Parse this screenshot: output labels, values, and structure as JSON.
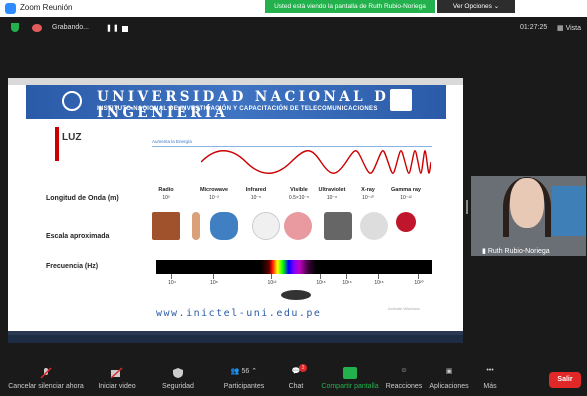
{
  "window": {
    "title": "Zoom Reunión"
  },
  "banner": {
    "share_text": "Usted está viendo la pantalla de Ruth Rubio-Noriega",
    "view_options": "Ver Opciones ⌄"
  },
  "meeting": {
    "recording_label": "Grabando...",
    "clock": "01:27:25",
    "view_label": "Vista"
  },
  "slide": {
    "univ_name": "UNIVERSIDAD NACIONAL DE INGENIERÍA",
    "univ_sub": "INSTITUTO NACIONAL DE INVESTIGACIÓN Y CAPACITACIÓN DE TELECOMUNICACIONES",
    "topic": "LUZ",
    "energy_label": "Aumenta la Energía",
    "row_wavelength": "Longitud de Onda (m)",
    "row_scale": "Escala aproximada",
    "row_frequency": "Frecuencia (Hz)",
    "categories": [
      {
        "name": "Radio",
        "wl": "10³"
      },
      {
        "name": "Microwave",
        "wl": "10⁻²"
      },
      {
        "name": "Infrared",
        "wl": "10⁻⁵"
      },
      {
        "name": "Visible",
        "wl": "0.5×10⁻⁶"
      },
      {
        "name": "Ultraviolet",
        "wl": "10⁻⁸"
      },
      {
        "name": "X-ray",
        "wl": "10⁻¹⁰"
      },
      {
        "name": "Gamma ray",
        "wl": "10⁻¹²"
      }
    ],
    "frequencies": [
      "10⁴",
      "10⁸",
      "10¹²",
      "10¹⁵",
      "10¹⁶",
      "10¹⁸",
      "10²⁰"
    ],
    "website": "www.inictel-uni.edu.pe",
    "activate": "Activate Windows"
  },
  "participant": {
    "name": "Ruth Rubio-Noriega"
  },
  "toolbar": {
    "mute": "Cancelar silenciar ahora",
    "video": "Iniciar video",
    "security": "Seguridad",
    "participants": "Participantes",
    "participants_count": "56",
    "chat": "Chat",
    "chat_badge": "3",
    "share": "Compartir pantalla",
    "reactions": "Reacciones",
    "apps": "Aplicaciones",
    "more": "Más",
    "leave": "Salir"
  },
  "colors": {
    "brand": "#2b5ba8",
    "share_green": "#23b14d",
    "leave_red": "#e02828"
  }
}
